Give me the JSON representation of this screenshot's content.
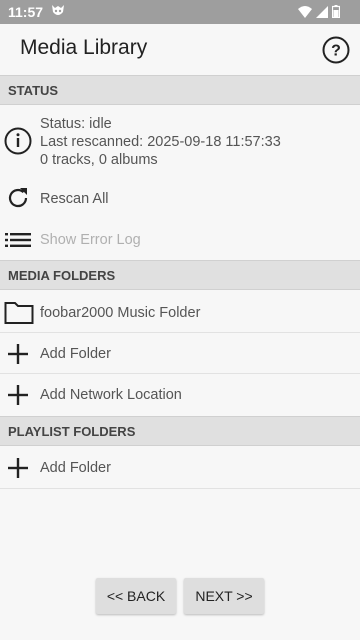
{
  "statusbar": {
    "time": "11:57"
  },
  "appbar": {
    "title": "Media Library"
  },
  "sections": {
    "status": "STATUS",
    "media_folders": "MEDIA FOLDERS",
    "playlist_folders": "PLAYLIST FOLDERS"
  },
  "status_info": {
    "status": "Status: idle",
    "last_rescanned": "Last rescanned: 2025-09-18 11:57:33",
    "counts": "0 tracks, 0 albums"
  },
  "actions": {
    "rescan_all": "Rescan All",
    "show_error_log": "Show Error Log"
  },
  "media_folders": {
    "folder_name": "foobar2000 Music Folder",
    "add_folder": "Add Folder",
    "add_network": "Add Network Location"
  },
  "playlist_folders": {
    "add_folder": "Add Folder"
  },
  "nav": {
    "back": "<< BACK",
    "next": "NEXT >>"
  }
}
